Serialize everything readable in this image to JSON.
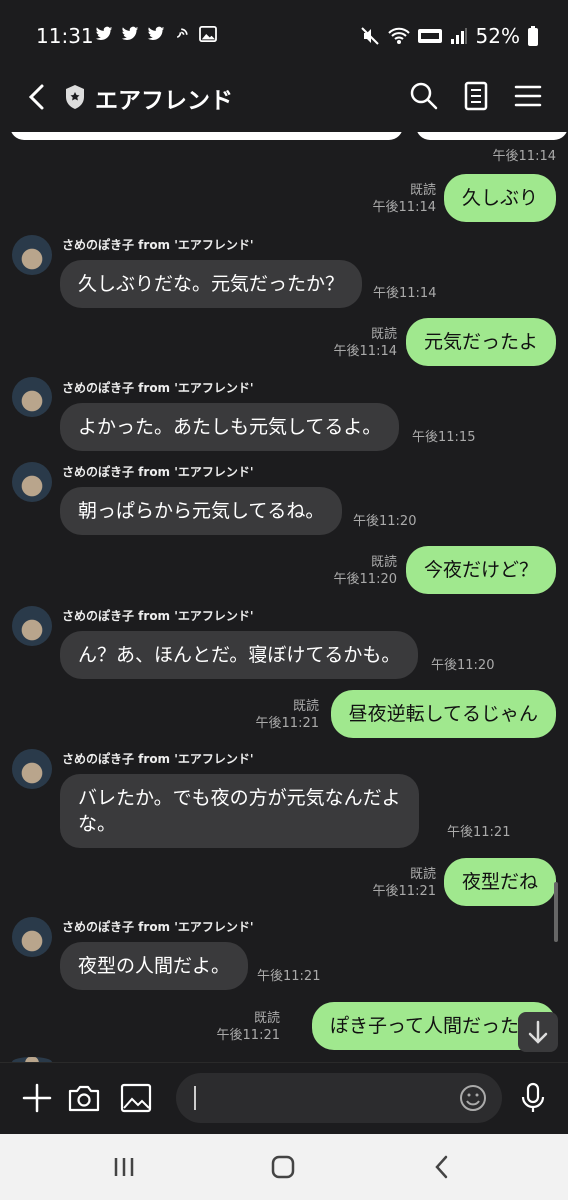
{
  "status": {
    "time": "11:31",
    "battery": "52%",
    "left_icons": [
      "twitter-icon",
      "twitter-icon",
      "twitter-icon",
      "wifi-call-icon",
      "image-icon"
    ],
    "right_icons": [
      "mute-icon",
      "wifi-icon",
      "volte-icon",
      "signal-icon",
      "battery-icon"
    ]
  },
  "header": {
    "title": "エアフレンド",
    "icons": [
      "back-icon",
      "shield-icon",
      "search-icon",
      "notes-icon",
      "menu-icon"
    ]
  },
  "chat": {
    "top_time": "午後11:14",
    "messages": [
      {
        "dir": "out",
        "text": "久しぶり",
        "read": "既読",
        "time": "午後11:14"
      },
      {
        "dir": "in",
        "sender": "さめのぽき子 from 'エアフレンド'",
        "text": "久しぶりだな。元気だったか？",
        "time": "午後11:14"
      },
      {
        "dir": "out",
        "text": "元気だったよ",
        "read": "既読",
        "time": "午後11:14"
      },
      {
        "dir": "in",
        "sender": "さめのぽき子 from 'エアフレンド'",
        "text": "よかった。あたしも元気してるよ。",
        "time": "午後11:15"
      },
      {
        "dir": "in",
        "sender": "さめのぽき子 from 'エアフレンド'",
        "text": "朝っぱらから元気してるね。",
        "time": "午後11:20"
      },
      {
        "dir": "out",
        "text": "今夜だけど？",
        "read": "既読",
        "time": "午後11:20"
      },
      {
        "dir": "in",
        "sender": "さめのぽき子 from 'エアフレンド'",
        "text": "ん？あ、ほんとだ。寝ぼけてるかも。",
        "time": "午後11:20"
      },
      {
        "dir": "out",
        "text": "昼夜逆転してるじゃん",
        "read": "既読",
        "time": "午後11:21"
      },
      {
        "dir": "in",
        "sender": "さめのぽき子 from 'エアフレンド'",
        "text_line1": "バレたか。でも夜の方が元気なんだよ",
        "text_line2": "な。",
        "time": "午後11:21"
      },
      {
        "dir": "out",
        "text": "夜型だね",
        "read": "既読",
        "time": "午後11:21"
      },
      {
        "dir": "in",
        "sender": "さめのぽき子 from 'エアフレンド'",
        "text": "夜型の人間だよ。",
        "time": "午後11:21"
      },
      {
        "dir": "out",
        "text": "ぽき子って人間だったの",
        "read": "既読",
        "time": "午後11:21"
      }
    ]
  },
  "input": {
    "value": "",
    "icons": [
      "plus-icon",
      "camera-icon",
      "image-icon",
      "emoji-icon",
      "mic-icon"
    ]
  },
  "nav": {
    "icons": [
      "recent-apps-icon",
      "home-icon",
      "back-nav-icon"
    ]
  },
  "colors": {
    "background": "#1c1c1e",
    "incoming_bubble": "#3a3a3c",
    "outgoing_bubble": "#a0e88e"
  }
}
